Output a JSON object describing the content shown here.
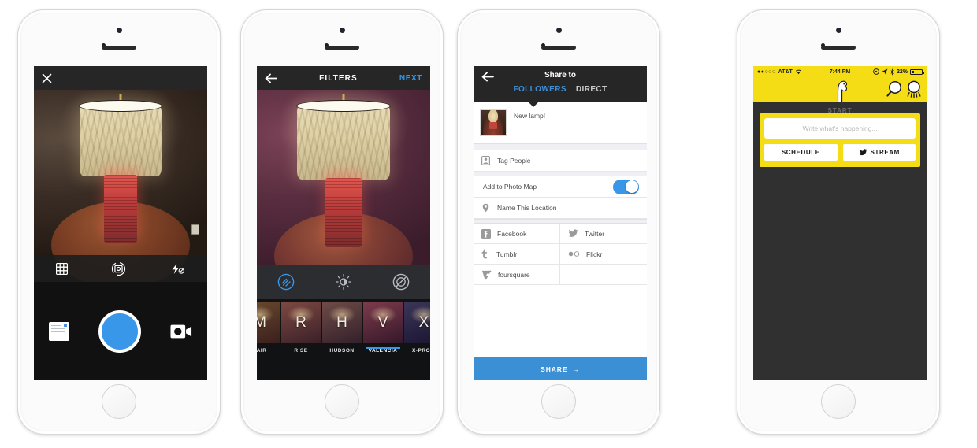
{
  "meta": {
    "description": "Four iPhone mockups: Instagram camera, Instagram filters, Instagram share-to screen, and Meerkat live-stream composer",
    "colors": {
      "instagram_blue": "#3897e8",
      "share_blue": "#3b8fd4",
      "meerkat_yellow": "#f5dd15",
      "dark_bar": "#262626",
      "dark_bg": "#303030"
    }
  },
  "phone1": {
    "name": "instagram-camera",
    "topbar": {
      "close_icon": "close-icon"
    },
    "controls": [
      {
        "icon": "grid-icon",
        "label": "Grid"
      },
      {
        "icon": "camera-rotate-icon",
        "label": "Switch camera"
      },
      {
        "icon": "flash-off-icon",
        "label": "Flash off"
      }
    ],
    "shutter": {
      "icon": "shutter-button",
      "label": "Capture"
    },
    "gallery": {
      "icon": "gallery-thumbnail",
      "label": "Library"
    },
    "video": {
      "icon": "video-camera-icon",
      "label": "Video"
    }
  },
  "phone2": {
    "name": "instagram-filters",
    "topbar": {
      "back_icon": "arrow-left-icon",
      "title": "FILTERS",
      "next_label": "NEXT"
    },
    "tools": [
      {
        "icon": "filter-icon",
        "label": "Filter",
        "selected": true
      },
      {
        "icon": "brightness-icon",
        "label": "Lux",
        "selected": false
      },
      {
        "icon": "blur-icon",
        "label": "Blur",
        "selected": false
      }
    ],
    "filters": [
      {
        "letter": "M",
        "name": "FAIR",
        "selected": false
      },
      {
        "letter": "R",
        "name": "RISE",
        "selected": false
      },
      {
        "letter": "H",
        "name": "HUDSON",
        "selected": false
      },
      {
        "letter": "V",
        "name": "VALENCIA",
        "selected": true
      },
      {
        "letter": "X",
        "name": "X-PRO II",
        "selected": false
      }
    ]
  },
  "phone3": {
    "name": "instagram-share",
    "topbar": {
      "back_icon": "arrow-left-icon",
      "title": "Share to",
      "tabs": [
        {
          "label": "FOLLOWERS",
          "active": true
        },
        {
          "label": "DIRECT",
          "active": false
        }
      ]
    },
    "caption": "New lamp!",
    "rows": [
      {
        "icon": "tag-people-icon",
        "label": "Tag People"
      }
    ],
    "photo_map": {
      "label": "Add to Photo Map",
      "toggle_on": true
    },
    "location": {
      "icon": "location-pin-icon",
      "label": "Name This Location"
    },
    "social": [
      {
        "icon": "facebook-icon",
        "label": "Facebook"
      },
      {
        "icon": "twitter-icon",
        "label": "Twitter"
      },
      {
        "icon": "tumblr-icon",
        "label": "Tumblr"
      },
      {
        "icon": "flickr-icon",
        "label": "Flickr"
      },
      {
        "icon": "foursquare-icon",
        "label": "foursquare"
      },
      {
        "icon": "",
        "label": ""
      }
    ],
    "share_button": {
      "label": "SHARE",
      "arrow": "→"
    }
  },
  "phone4": {
    "name": "meerkat-composer",
    "status": {
      "signal_dots": "●●○○○",
      "carrier": "AT&T",
      "wifi_icon": "wifi-icon",
      "time": "7:44 PM",
      "rotation_lock_icon": "rotation-lock-icon",
      "location_icon": "location-arrow-icon",
      "bluetooth_icon": "bluetooth-icon",
      "battery": "22%"
    },
    "header": {
      "logo_icon": "meerkat-logo-icon",
      "search_icon": "search-icon",
      "people_icon": "people-icon"
    },
    "start_label": "START",
    "composer": {
      "placeholder": "Write what's happening...",
      "value": "",
      "schedule_label": "SCHEDULE",
      "stream_label": "STREAM",
      "stream_icon": "twitter-bird-icon"
    }
  }
}
